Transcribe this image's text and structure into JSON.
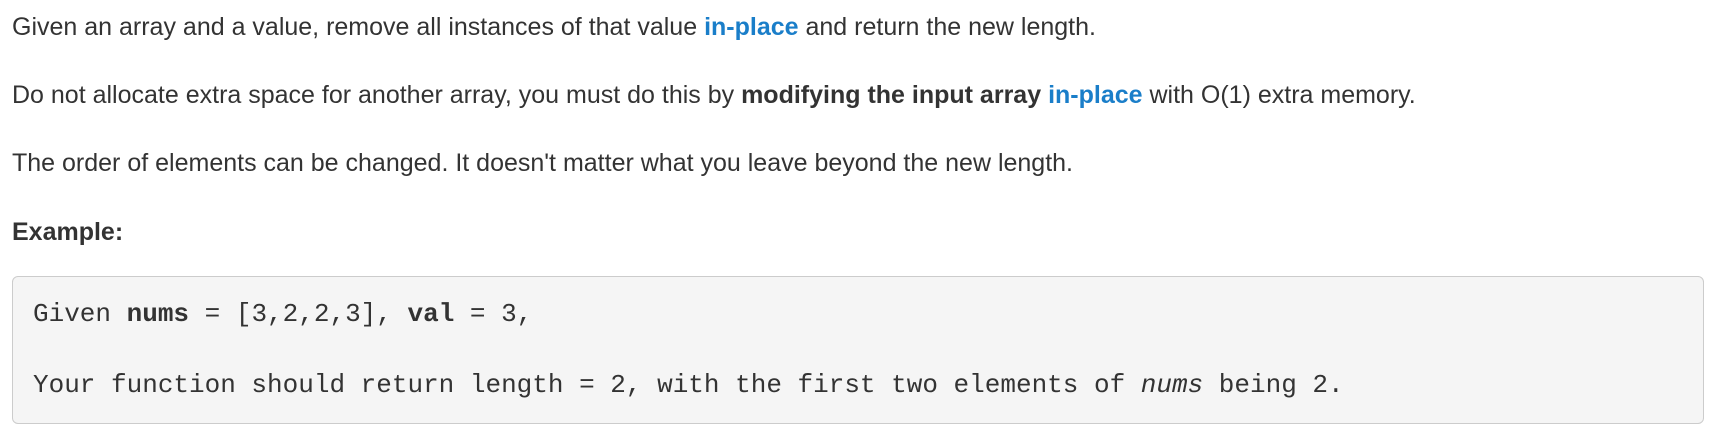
{
  "paragraphs": {
    "p1": {
      "text_a": "Given an array and a value, remove all instances of that value ",
      "link": "in-place",
      "text_b": " and return the new length."
    },
    "p2": {
      "text_a": "Do not allocate extra space for another array, you must do this by ",
      "bold": "modifying the input array",
      "text_b": " ",
      "link": "in-place",
      "text_c": " with O(1) extra memory."
    },
    "p3": {
      "text": "The order of elements can be changed. It doesn't matter what you leave beyond the new length."
    }
  },
  "example": {
    "heading": "Example:",
    "code_line_1": {
      "a": "Given ",
      "nums_label": "nums",
      "b": " = [3,2,2,3], ",
      "val_label": "val",
      "c": " = 3,"
    },
    "code_line_2": {
      "a": "Your function should return length = 2, with the first two elements of ",
      "nums_ital": "nums",
      "b": " being 2."
    }
  },
  "colors": {
    "link": "#1a7ec9",
    "text": "#333333",
    "code_background": "#f5f5f5",
    "code_border": "#cccccc"
  }
}
